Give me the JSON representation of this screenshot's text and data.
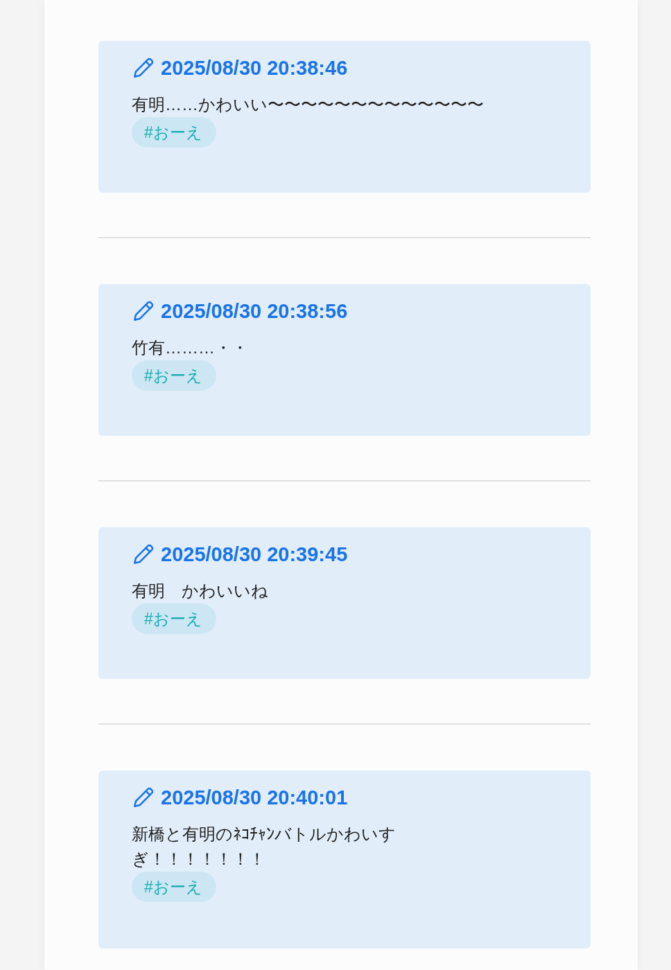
{
  "posts": [
    {
      "timestamp": "2025/08/30 20:38:46",
      "lines": [
        "有明……かわいい〜〜〜〜〜〜〜〜〜〜〜〜〜"
      ],
      "tags": [
        "#おーえ"
      ]
    },
    {
      "timestamp": "2025/08/30 20:38:56",
      "lines": [
        "竹有………・・"
      ],
      "tags": [
        "#おーえ"
      ]
    },
    {
      "timestamp": "2025/08/30 20:39:45",
      "lines": [
        "有明　かわいいね"
      ],
      "tags": [
        "#おーえ"
      ]
    },
    {
      "timestamp": "2025/08/30 20:40:01",
      "lines": [
        "新橋と有明のﾈｺﾁｬﾝバトルかわいす",
        "ぎ！！！！！！！"
      ],
      "tags": [
        "#おーえ"
      ]
    }
  ]
}
